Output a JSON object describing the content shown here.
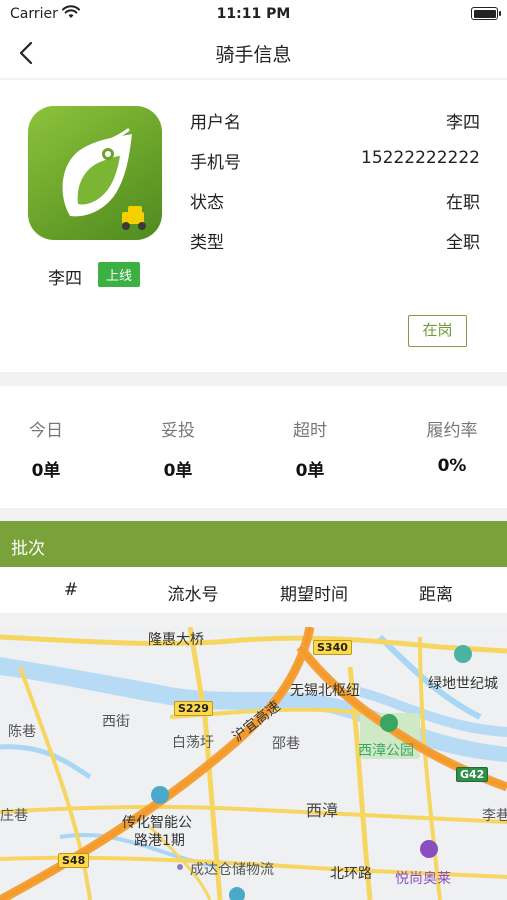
{
  "status_bar": {
    "carrier": "Carrier",
    "time": "11:11 PM"
  },
  "nav": {
    "title": "骑手信息"
  },
  "rider": {
    "name": "李四",
    "online_badge": "上线",
    "fields": [
      {
        "key": "用户名",
        "value": "李四"
      },
      {
        "key": "手机号",
        "value": "15222222222"
      },
      {
        "key": "状态",
        "value": "在职"
      },
      {
        "key": "类型",
        "value": "全职"
      }
    ],
    "duty_button": "在岗"
  },
  "stats": [
    {
      "label": "今日",
      "value": "0单"
    },
    {
      "label": "妥投",
      "value": "0单"
    },
    {
      "label": "超时",
      "value": "0单"
    },
    {
      "label": "履约率",
      "value": "0%"
    }
  ],
  "batch": {
    "title": "批次",
    "columns": [
      "#",
      "流水号",
      "期望时间",
      "距离"
    ]
  },
  "map": {
    "labels": {
      "bridge": "隆惠大桥",
      "hub": "无锡北枢纽",
      "greenland": "绿地世纪城",
      "chenxiang": "陈巷",
      "xijie": "西街",
      "baidangyu": "白荡圩",
      "highway": "沪宜高速",
      "shaoxiang": "邵巷",
      "park": "西漳公园",
      "lixiang": "李巷",
      "zhuxiang": "庄巷",
      "xizhang": "西漳",
      "chuanhua1": "传化智能公",
      "chuanhua2": "路港1期",
      "chengda": "成达仓储物流",
      "beihuan": "北环路",
      "yueshang": "悦尚奥莱",
      "s340": "S340",
      "s229": "S229",
      "s48": "S48",
      "g42": "G42"
    }
  },
  "colors": {
    "accent": "#79a33a",
    "online": "#3cb043"
  }
}
